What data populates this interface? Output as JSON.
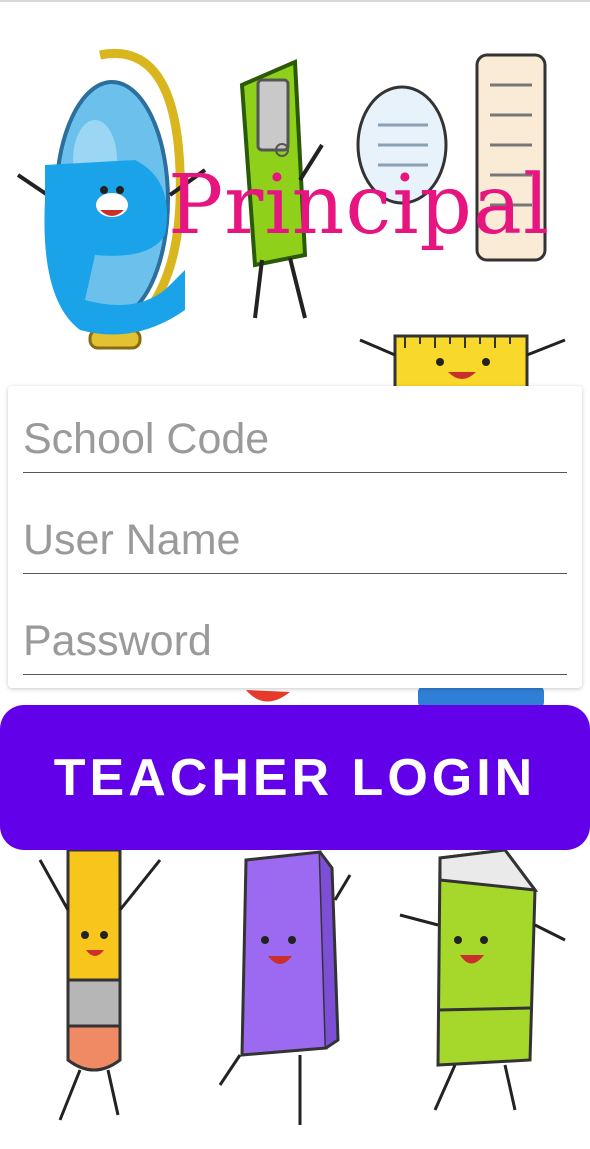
{
  "app": {
    "logo_text": "Principal",
    "logo_initial": "e"
  },
  "colors": {
    "primary": "#6200ea",
    "logo_pink": "#e6157f",
    "logo_blue": "#1aa3e8"
  },
  "form": {
    "school_code": {
      "placeholder": "School Code",
      "value": ""
    },
    "user_name": {
      "placeholder": "User Name",
      "value": ""
    },
    "password": {
      "placeholder": "Password",
      "value": ""
    }
  },
  "login_button": {
    "label": "TEACHER LOGIN"
  },
  "illustrations": [
    "globe-character-icon",
    "sharpener-character-icon",
    "speech-bubble-icon",
    "notepad-icon",
    "ruler-character-icon",
    "pencil-character-icon",
    "book-character-icon",
    "eraser-character-icon"
  ]
}
